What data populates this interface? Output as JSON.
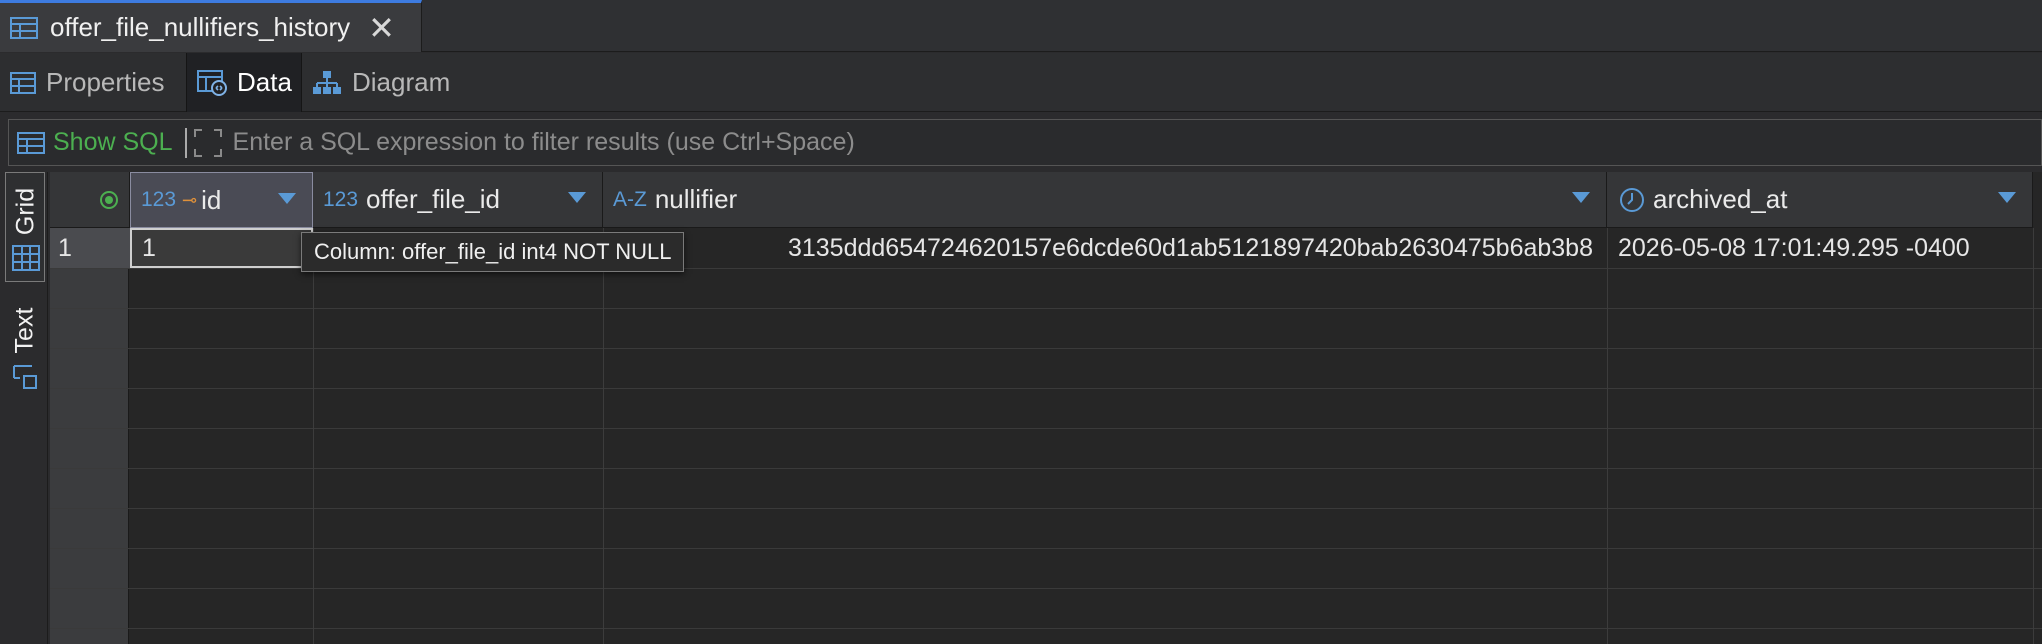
{
  "editor_tab": {
    "title": "offer_file_nullifiers_history"
  },
  "sub_tabs": [
    {
      "label": "Properties"
    },
    {
      "label": "Data"
    },
    {
      "label": "Diagram"
    }
  ],
  "filter": {
    "show_sql_label": "Show SQL",
    "placeholder": "Enter a SQL expression to filter results (use Ctrl+Space)"
  },
  "side_tabs": {
    "grid": "Grid",
    "text": "Text"
  },
  "columns": [
    {
      "type_label": "123",
      "name": "id",
      "key": true
    },
    {
      "type_label": "123",
      "name": "offer_file_id"
    },
    {
      "type_label": "A-Z",
      "name": "nullifier"
    },
    {
      "type_label": "clock",
      "name": "archived_at"
    }
  ],
  "rows": [
    {
      "num": "1",
      "id": "1",
      "offer_file_id": "",
      "nullifier": "3135ddd654724620157e6dcde60d1ab5121897420bab2630475b6ab3b8",
      "archived_at": "2026-05-08 17:01:49.295 -0400"
    }
  ],
  "tooltip": "Column: offer_file_id int4 NOT NULL",
  "colors": {
    "accent": "#3d7be0",
    "show_sql": "#4caf50",
    "type_blue": "#5a9ad6",
    "key_orange": "#e0913a"
  }
}
